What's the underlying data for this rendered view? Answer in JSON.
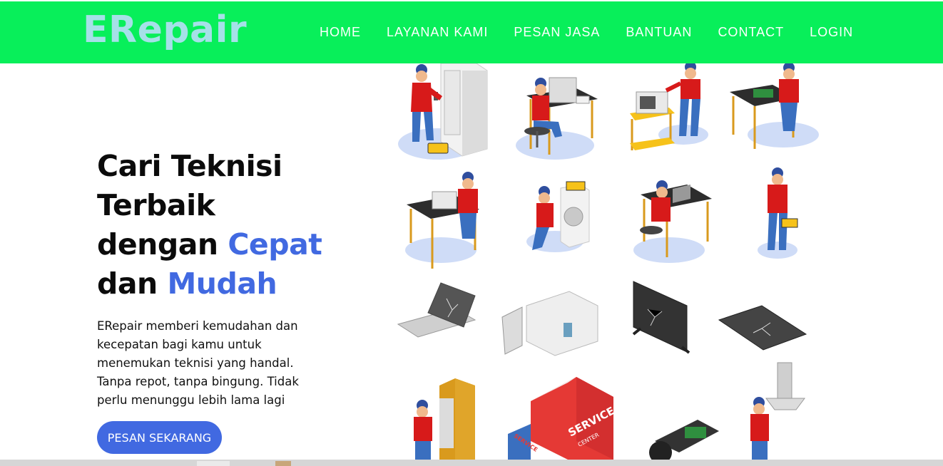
{
  "brand": {
    "name": "ERepair",
    "color": "#a6e0e8",
    "navbar_color": "#08ef5a"
  },
  "nav": {
    "items": [
      {
        "label": "HOME"
      },
      {
        "label": "LAYANAN KAMI"
      },
      {
        "label": "PESAN JASA"
      },
      {
        "label": "BANTUAN"
      },
      {
        "label": "CONTACT"
      },
      {
        "label": "LOGIN"
      }
    ]
  },
  "hero": {
    "heading": {
      "line1": "Cari Teknisi",
      "line2": "Terbaik",
      "line3_start": "dengan ",
      "line3_accent": "Cepat",
      "line4_start": "dan ",
      "line4_accent": "Mudah"
    },
    "description": "ERepair memberi kemudahan dan kecepatan bagi kamu untuk menemukan teknisi yang handal. Tanpa repot, tanpa bingung. Tidak perlu menunggu lebih lama lagi",
    "cta_label": "PESAN SEKARANG",
    "accent_color": "#4169e1"
  },
  "illustration": {
    "panels": [
      "technician-refrigerator-icon",
      "technician-computer-desk-icon",
      "technician-microwave-cart-icon",
      "technician-circuit-board-icon",
      "technician-printer-desk-icon",
      "technician-washing-machine-icon",
      "technician-laptop-desk-icon",
      "technician-toolbox-icon",
      "broken-laptop-icon",
      "broken-microwave-icon",
      "broken-tv-icon",
      "broken-tablet-icon",
      "technician-cabinet-icon",
      "service-truck-icon",
      "video-camera-icon",
      "technician-range-hood-icon"
    ],
    "truck_text": [
      "SERVICE",
      "CENTER",
      "SERVICE"
    ]
  }
}
